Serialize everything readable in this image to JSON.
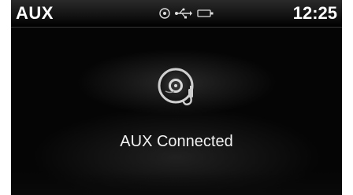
{
  "header": {
    "title": "AUX",
    "clock": "12:25",
    "status_icons": [
      "disc-icon",
      "usb-icon",
      "battery-icon"
    ]
  },
  "main": {
    "icon": "aux-disc-icon",
    "message": "AUX Connected"
  },
  "colors": {
    "background": "#000000",
    "text": "#ffffff",
    "icon": "#c8c8c8"
  }
}
